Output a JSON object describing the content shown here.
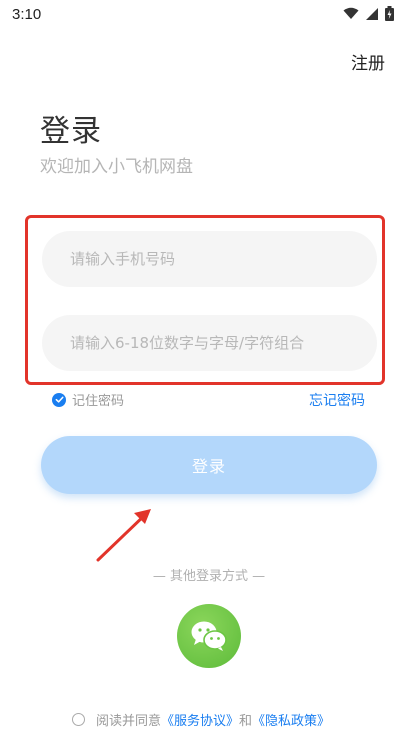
{
  "status_bar": {
    "time": "3:10",
    "icons": [
      "wifi-icon",
      "signal-icon",
      "battery-icon"
    ]
  },
  "header": {
    "register_label": "注册"
  },
  "main": {
    "title": "登录",
    "subtitle": "欢迎加入小飞机网盘",
    "phone_placeholder": "请输入手机号码",
    "password_placeholder": "请输入6-18位数字与字母/字符组合",
    "remember_label": "记住密码",
    "remember_checked": true,
    "forgot_label": "忘记密码",
    "login_label": "登录",
    "other_login_label": "— 其他登录方式 —"
  },
  "agreement": {
    "prefix": "阅读并同意",
    "service_link": "《服务协议》",
    "and": "和",
    "privacy_link": "《隐私政策》"
  },
  "colors": {
    "accent": "#1a7ef0",
    "login_button": "#b3d7fb",
    "wechat": "#6cc644",
    "annotation": "#e2342a"
  },
  "social_icons": [
    "wechat-icon"
  ]
}
